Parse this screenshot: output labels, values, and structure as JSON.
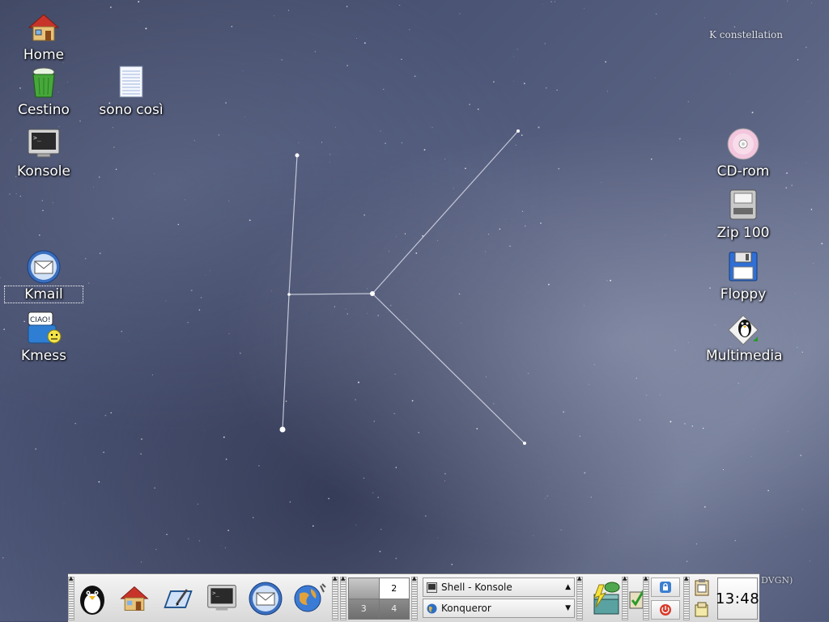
{
  "wallpaper": {
    "title": "K constellation",
    "corner_fragment": "DVGN)"
  },
  "desktop": {
    "icons": [
      {
        "id": "home",
        "label": "Home",
        "icon": "home-icon"
      },
      {
        "id": "trash",
        "label": "Cestino",
        "icon": "trash-icon"
      },
      {
        "id": "file",
        "label": "sono così",
        "icon": "text-file-icon"
      },
      {
        "id": "konsole",
        "label": "Konsole",
        "icon": "terminal-icon"
      },
      {
        "id": "kmail",
        "label": "Kmail",
        "icon": "mail-icon"
      },
      {
        "id": "kmess",
        "label": "Kmess",
        "icon": "messenger-icon"
      },
      {
        "id": "cdrom",
        "label": "CD-rom",
        "icon": "cdrom-icon"
      },
      {
        "id": "zip",
        "label": "Zip 100",
        "icon": "zip-drive-icon"
      },
      {
        "id": "floppy",
        "label": "Floppy",
        "icon": "floppy-icon"
      },
      {
        "id": "multimedia",
        "label": "Multimedia",
        "icon": "tux-multimedia-icon"
      }
    ]
  },
  "panel": {
    "quick_launch": [
      "k-menu-icon",
      "home-icon",
      "editor-icon",
      "terminal-icon",
      "mail-icon",
      "browser-globe-icon"
    ],
    "pager": {
      "desktops": [
        "1",
        "2",
        "3",
        "4"
      ],
      "active": "2",
      "shown_labels": [
        "",
        "2",
        "3",
        "4"
      ]
    },
    "tasks": [
      {
        "label": "Shell - Konsole",
        "icon": "terminal-icon"
      },
      {
        "label": "Konqueror",
        "icon": "globe-icon"
      }
    ],
    "tray": [
      "suse-update-icon",
      "clipboard-check-icon",
      "lock-icon",
      "logout-icon",
      "klipper-icon",
      "notes-icon"
    ],
    "clock": "13:48"
  },
  "colors": {
    "panel": "#e6e6e6",
    "accent": "#2b5fa8"
  }
}
